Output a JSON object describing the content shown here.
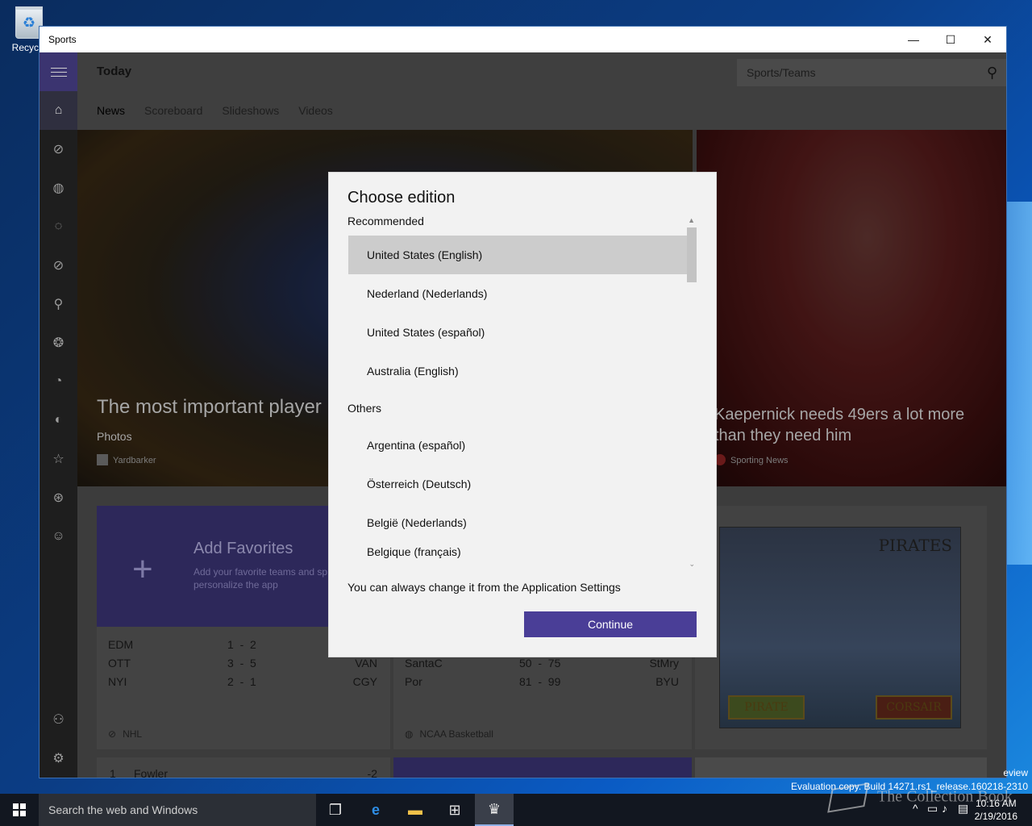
{
  "desktop": {
    "recycle_label": "Recycle"
  },
  "window": {
    "title": "Sports",
    "minimize": "—",
    "maximize": "☐",
    "close": "✕"
  },
  "header": {
    "title": "Today",
    "search_placeholder": "Sports/Teams"
  },
  "tabs": [
    {
      "label": "News"
    },
    {
      "label": "Scoreboard"
    },
    {
      "label": "Slideshows"
    },
    {
      "label": "Videos"
    }
  ],
  "hero": {
    "left": {
      "title": "The most important player",
      "subtitle": "Photos",
      "source": "Yardbarker"
    },
    "right": {
      "title": "Kaepernick needs 49ers a lot more than they need him",
      "source": "Sporting News"
    }
  },
  "favorites": {
    "title": "Add Favorites",
    "subtitle": "Add your favorite teams and sp personalize the app"
  },
  "scores_nhl": {
    "rows": [
      {
        "home": "EDM",
        "score": "1  -  2",
        "away": ""
      },
      {
        "home": "OTT",
        "score": "3  -  5",
        "away": "VAN"
      },
      {
        "home": "NYI",
        "score": "2  -  1",
        "away": "CGY"
      }
    ],
    "league": "NHL"
  },
  "scores_ncaa": {
    "rows": [
      {
        "home": "SantaC",
        "score": "50  -  75",
        "away": "StMry"
      },
      {
        "home": "Por",
        "score": "81  -  99",
        "away": "BYU"
      }
    ],
    "league": "NCAA Basketball"
  },
  "golf": {
    "rank": "1",
    "name": "Fowler",
    "score": "-2"
  },
  "ad": {
    "title": "PIRATES",
    "button_left": "PIRATE",
    "button_right": "CORSAIR"
  },
  "dialog": {
    "title": "Choose edition",
    "section_recommended": "Recommended",
    "recommended": [
      "United States (English)",
      "Nederland (Nederlands)",
      "United States (español)",
      "Australia (English)"
    ],
    "section_others": "Others",
    "others": [
      "Argentina (español)",
      "Österreich (Deutsch)",
      "België (Nederlands)",
      "Belgique (français)"
    ],
    "note": "You can always change it from the Application Settings",
    "continue": "Continue"
  },
  "system": {
    "evaluation": "Evaluation copy. Build 14271.rs1_release.160218-2310",
    "preview": "eview",
    "time": "10:16 AM",
    "date": "2/19/2016",
    "watermark": "The Collection Book",
    "taskbar_search": "Search the web and Windows"
  },
  "colors": {
    "accent": "#4a3e97",
    "nav_header": "#3b3470"
  }
}
